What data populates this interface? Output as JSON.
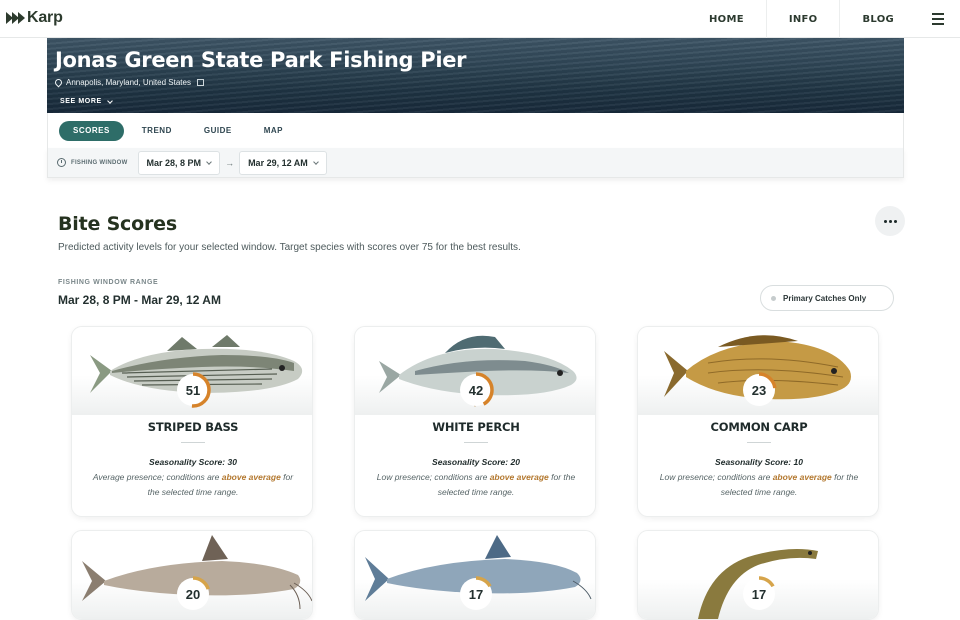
{
  "brand": {
    "name": "Karp"
  },
  "nav": {
    "items": [
      "HOME",
      "INFO",
      "BLOG"
    ]
  },
  "location": {
    "title": "Jonas Green State Park Fishing Pier",
    "address": "Annapolis, Maryland, United States",
    "see_more": "SEE MORE"
  },
  "tabs": {
    "items": [
      "SCORES",
      "TREND",
      "GUIDE",
      "MAP"
    ],
    "active": "SCORES"
  },
  "window": {
    "label": "FISHING WINDOW",
    "start": "Mar 28, 8 PM",
    "end": "Mar 29, 12 AM",
    "arrow": "→"
  },
  "section": {
    "title": "Bite Scores",
    "description": "Predicted activity levels for your selected window. Target species with scores over 75 for the best results.",
    "range_label": "FISHING WINDOW RANGE",
    "range_value": "Mar 28, 8 PM - Mar 29, 12 AM",
    "toggle_label": "Primary Catches Only"
  },
  "colors": {
    "accent": "#2e6d68",
    "score_ring": "#d6832a",
    "highlight": "#b3782f"
  },
  "cards": [
    {
      "name": "STRIPED BASS",
      "score": "51",
      "score_value": 51,
      "season": "Seasonality Score: 30",
      "note_pre": "Average presence; conditions are ",
      "note_hl": "above average",
      "note_post": " for the selected time range."
    },
    {
      "name": "WHITE PERCH",
      "score": "42",
      "score_value": 42,
      "season": "Seasonality Score: 20",
      "note_pre": "Low presence; conditions are ",
      "note_hl": "above average",
      "note_post": " for the selected time range."
    },
    {
      "name": "COMMON CARP",
      "score": "23",
      "score_value": 23,
      "season": "Seasonality Score: 10",
      "note_pre": "Low presence; conditions are ",
      "note_hl": "above average",
      "note_post": " for the selected time range."
    },
    {
      "score": "20",
      "score_value": 20
    },
    {
      "score": "17",
      "score_value": 17
    },
    {
      "score": "17",
      "score_value": 17
    }
  ]
}
